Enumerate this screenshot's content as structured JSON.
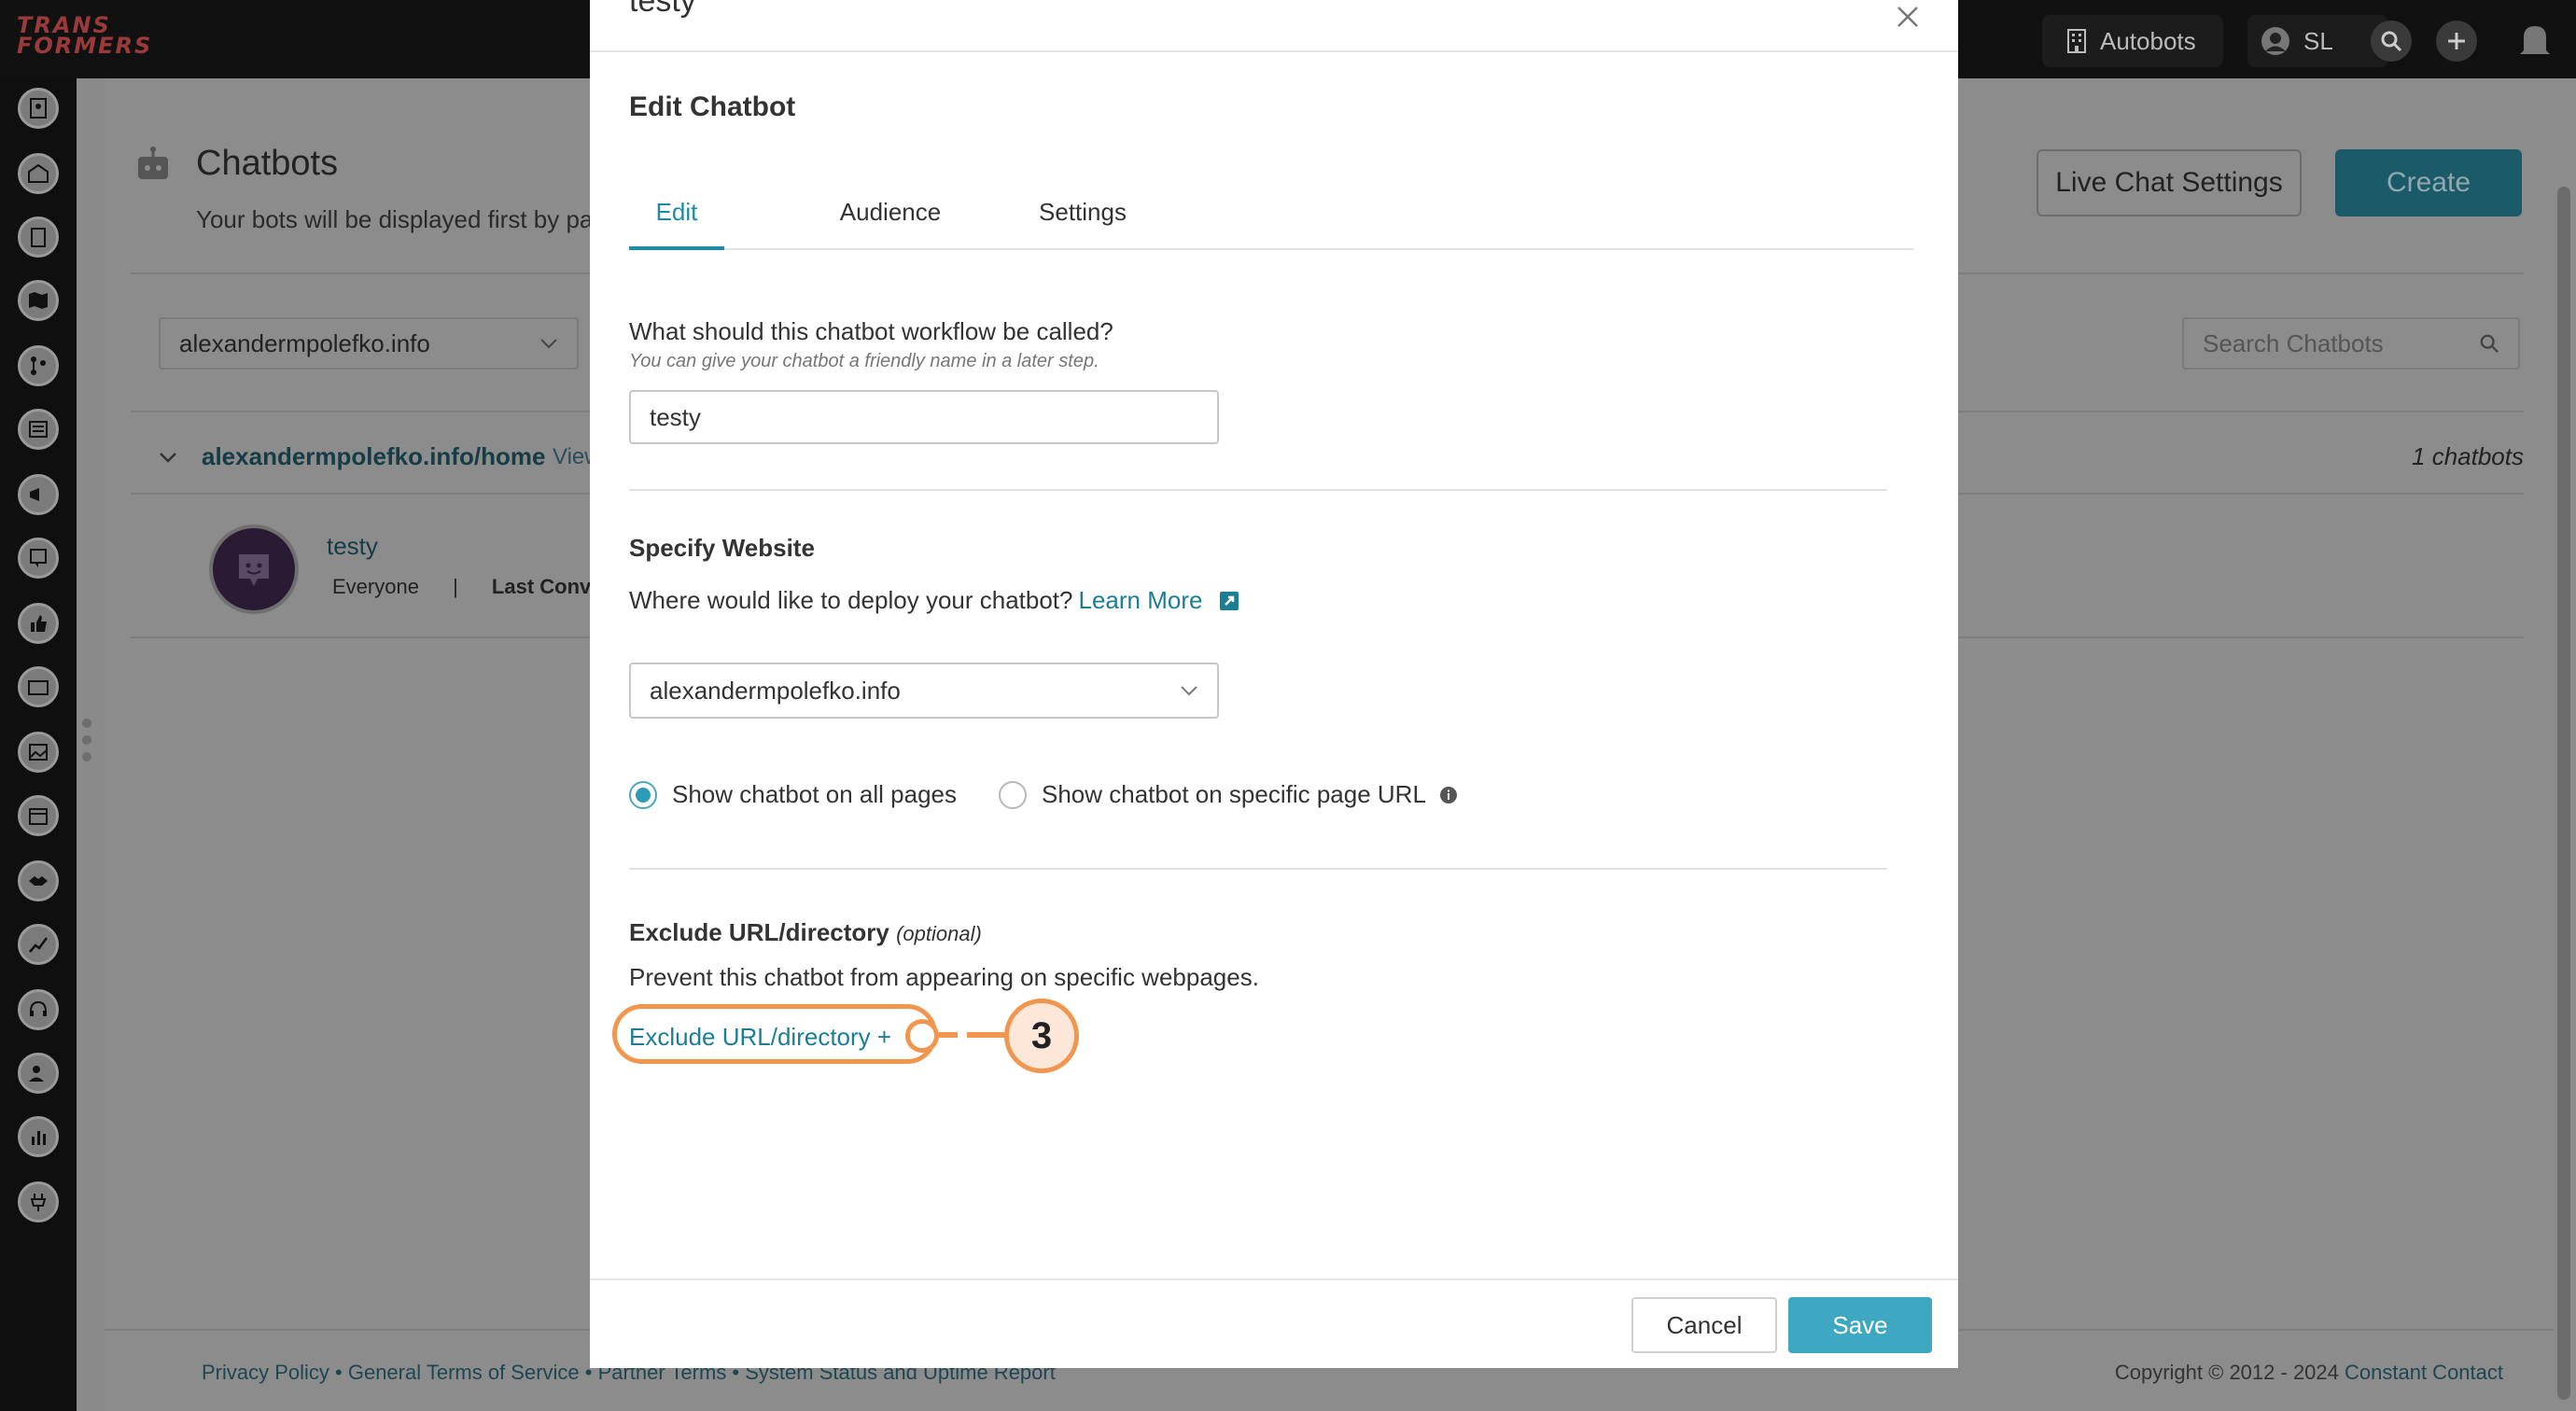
{
  "app": {
    "logo_lines": [
      "TRANS",
      "FORMERS"
    ],
    "org_button": "Autobots",
    "user_initials": "SL"
  },
  "page": {
    "title": "Chatbots",
    "subtitle": "Your bots will be displayed first by page",
    "live_chat_settings": "Live Chat Settings",
    "create": "Create",
    "site_filter": "alexandermpolefko.info",
    "search_placeholder": "Search Chatbots",
    "group_label": "alexandermpolefko.info/home",
    "group_view": "View",
    "chatbot_count": "1 chatbots",
    "bot_name": "testy",
    "bot_audience": "Everyone",
    "bot_separator": "|",
    "bot_last": "Last Convers"
  },
  "footer": {
    "links": "Privacy Policy • General Terms of Service • Partner Terms • System Status and Uptime Report",
    "copyright": "Copyright © 2012 - 2024",
    "company": "Constant Contact"
  },
  "modal": {
    "title": "testy",
    "heading": "Edit Chatbot",
    "tabs": [
      "Edit",
      "Audience",
      "Settings"
    ],
    "name_question": "What should this chatbot workflow be called?",
    "name_hint": "You can give your chatbot a friendly name in a later step.",
    "name_value": "testy",
    "website_heading": "Specify Website",
    "website_question": "Where would like to deploy your chatbot?",
    "learn_more": "Learn More",
    "website_value": "alexandermpolefko.info",
    "radio_all": "Show chatbot on all pages",
    "radio_specific": "Show chatbot on specific page URL",
    "exclude_heading": "Exclude URL/directory",
    "exclude_optional": "(optional)",
    "exclude_desc": "Prevent this chatbot from appearing on specific webpages.",
    "exclude_link": "Exclude URL/directory +",
    "callout_number": "3",
    "cancel": "Cancel",
    "save": "Save"
  },
  "colors": {
    "accent": "#1e8ba4",
    "save_button": "#3ea7c1",
    "callout": "#f0964f"
  }
}
